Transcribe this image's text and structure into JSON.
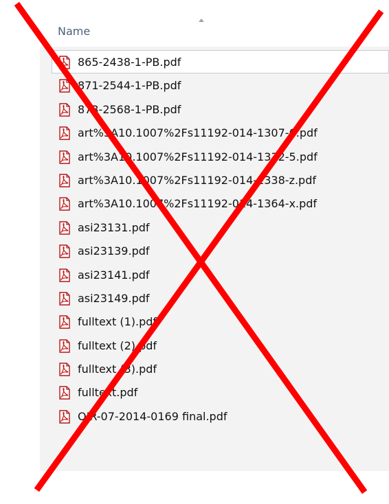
{
  "header": {
    "name_column": "Name"
  },
  "files": [
    {
      "name": "865-2438-1-PB.pdf",
      "icon": "pdf-icon"
    },
    {
      "name": "871-2544-1-PB.pdf",
      "icon": "pdf-icon"
    },
    {
      "name": "873-2568-1-PB.pdf",
      "icon": "pdf-icon"
    },
    {
      "name": "art%3A10.1007%2Fs11192-014-1307-6.pdf",
      "icon": "pdf-icon"
    },
    {
      "name": "art%3A10.1007%2Fs11192-014-1332-5.pdf",
      "icon": "pdf-icon"
    },
    {
      "name": "art%3A10.1007%2Fs11192-014-1338-z.pdf",
      "icon": "pdf-icon"
    },
    {
      "name": "art%3A10.1007%2Fs11192-014-1364-x.pdf",
      "icon": "pdf-icon"
    },
    {
      "name": "asi23131.pdf",
      "icon": "pdf-icon"
    },
    {
      "name": "asi23139.pdf",
      "icon": "pdf-icon"
    },
    {
      "name": "asi23141.pdf",
      "icon": "pdf-icon"
    },
    {
      "name": "asi23149.pdf",
      "icon": "pdf-icon"
    },
    {
      "name": "fulltext (1).pdf",
      "icon": "pdf-icon"
    },
    {
      "name": "fulltext (2).pdf",
      "icon": "pdf-icon"
    },
    {
      "name": "fulltext (3).pdf",
      "icon": "pdf-icon"
    },
    {
      "name": "fulltext.pdf",
      "icon": "pdf-icon"
    },
    {
      "name": "OIR-07-2014-0169 final.pdf",
      "icon": "pdf-icon"
    }
  ],
  "overlay": {
    "icon": "red-cross-icon",
    "color": "#ff0000"
  }
}
